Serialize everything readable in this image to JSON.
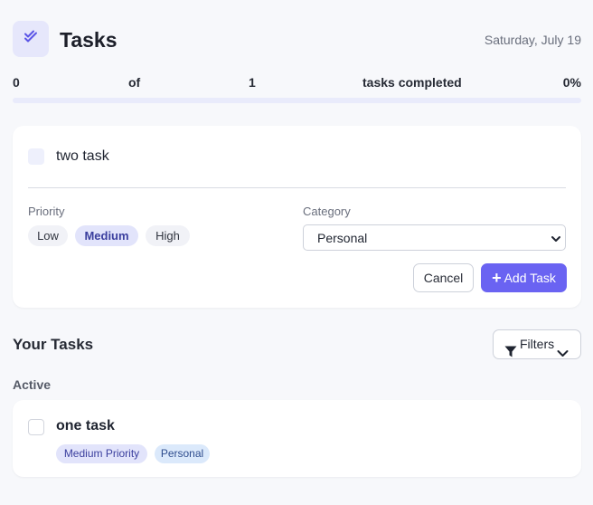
{
  "header": {
    "title": "Tasks",
    "date": "Saturday, July 19"
  },
  "progress": {
    "completed": "0",
    "of_label": "of",
    "total": "1",
    "suffix": "tasks completed",
    "percent_label": "0%",
    "fraction": 0
  },
  "new_task": {
    "value": "two task",
    "priority_label": "Priority",
    "priorities": [
      "Low",
      "Medium",
      "High"
    ],
    "selected_priority": "Medium",
    "category_label": "Category",
    "category_value": "Personal",
    "cancel_label": "Cancel",
    "add_label": "Add Task"
  },
  "tasks_section": {
    "title": "Your Tasks",
    "filters_label": "Filters",
    "group_label": "Active",
    "items": [
      {
        "title": "one task",
        "priority_tag": "Medium Priority",
        "category_tag": "Personal"
      }
    ]
  },
  "colors": {
    "accent": "#6a63f2",
    "background": "#f7f8fb"
  }
}
